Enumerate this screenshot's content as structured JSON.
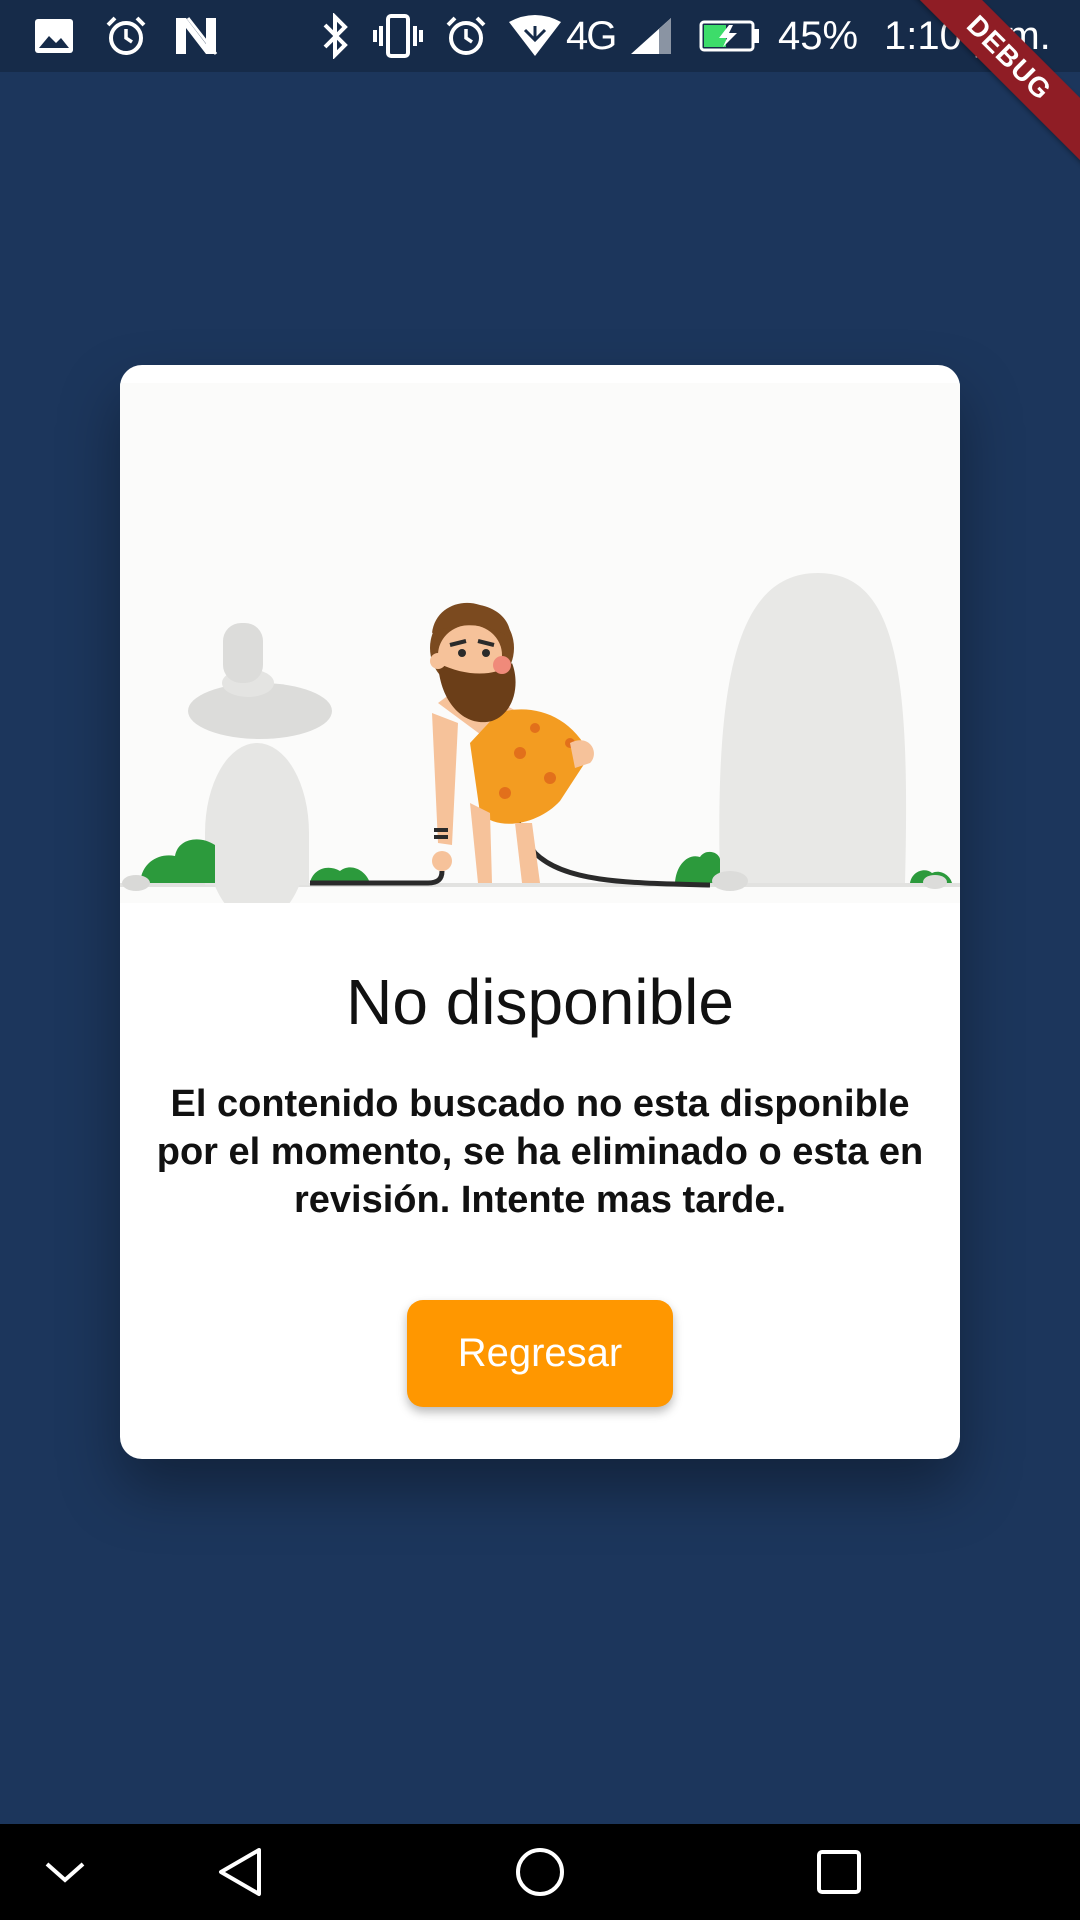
{
  "status_bar": {
    "battery_percent": "45%",
    "time": "1:10 p.m.",
    "network": "4G",
    "icons": [
      "image-icon",
      "alarm-icon",
      "n-notification-icon",
      "bluetooth-icon",
      "vibrate-icon",
      "alarm-icon",
      "wifi-icon",
      "signal-icon",
      "battery-charging-icon"
    ]
  },
  "debug_banner": "DEBUG",
  "dialog": {
    "title": "No disponible",
    "message": "El contenido buscado no esta disponible por el momento, se ha eliminado o esta en revisión. Intente mas tarde.",
    "button_label": "Regresar"
  },
  "nav_bar": {
    "icons": [
      "chevron-down-icon",
      "back-icon",
      "home-icon",
      "recents-icon"
    ]
  },
  "colors": {
    "background": "#1c365c",
    "status_bar": "#162b49",
    "accent": "#ff9700",
    "card": "#ffffff"
  }
}
